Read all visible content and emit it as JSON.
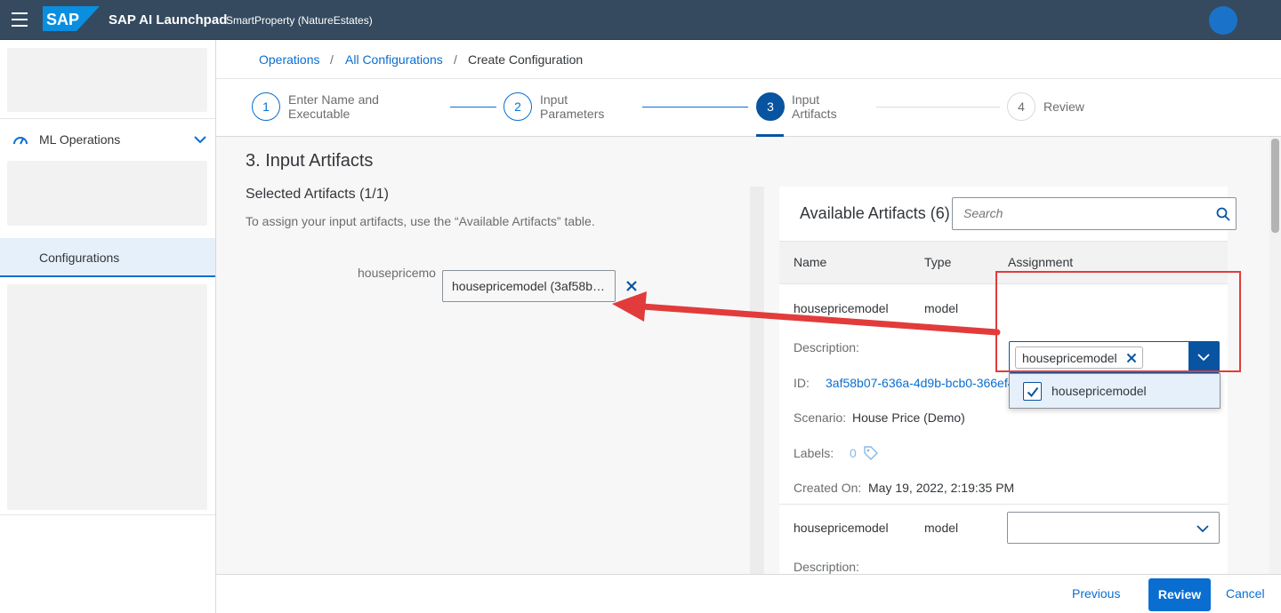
{
  "shell": {
    "logo_text": "SAP",
    "title": "SAP AI Launchpad",
    "subtitle": "SmartProperty (NatureEstates)",
    "icons": {
      "menu": "hamburger-icon",
      "avatar": "user-avatar"
    }
  },
  "sidenav": {
    "ml_operations": "ML Operations",
    "configurations": "Configurations",
    "icons": {
      "ml": "gauge-icon",
      "expand": "chevron-down-icon"
    }
  },
  "breadcrumb": {
    "items": [
      "Operations",
      "All Configurations"
    ],
    "separator": "/",
    "current": "Create Configuration"
  },
  "wizard": {
    "steps": [
      {
        "number": "1",
        "line1": "Enter Name and",
        "line2": "Executable"
      },
      {
        "number": "2",
        "line1": "Input",
        "line2": "Parameters"
      },
      {
        "number": "3",
        "line1": "Input",
        "line2": "Artifacts"
      },
      {
        "number": "4",
        "line1": "Review",
        "line2": ""
      }
    ],
    "active_step": "3"
  },
  "main": {
    "section_title": "3. Input Artifacts",
    "selected_title": "Selected Artifacts (1/1)",
    "selected_hint": "To assign your input artifacts, use the “Available Artifacts” table.",
    "artifact_label": "housepricemo",
    "artifact_token": "housepricemodel (3af58b…"
  },
  "available": {
    "title": "Available Artifacts (6)",
    "search_placeholder": "Search",
    "columns": [
      "Name",
      "Type",
      "Assignment"
    ],
    "rows": [
      {
        "name": "housepricemodel",
        "type": "model",
        "description_label": "Description:",
        "id_label": "ID:",
        "id": "3af58b07-636a-4d9b-bcb0-366ef4f286cf",
        "scenario_label": "Scenario:",
        "scenario": "House Price (Demo)",
        "labels_label": "Labels:",
        "labels_count": "0",
        "created_label": "Created On:",
        "created": "May 19, 2022, 2:19:35 PM",
        "assignment_token": "housepricemodel",
        "option": "housepricemodel"
      },
      {
        "name": "housepricemodel",
        "type": "model",
        "description_label": "Description:"
      }
    ]
  },
  "footer": {
    "previous": "Previous",
    "review": "Review",
    "cancel": "Cancel"
  },
  "colors": {
    "shell": "#354a5f",
    "brand_blue": "#0a6ed1",
    "emphasized": "#0854a0",
    "annotation_red": "#e23b3b"
  }
}
